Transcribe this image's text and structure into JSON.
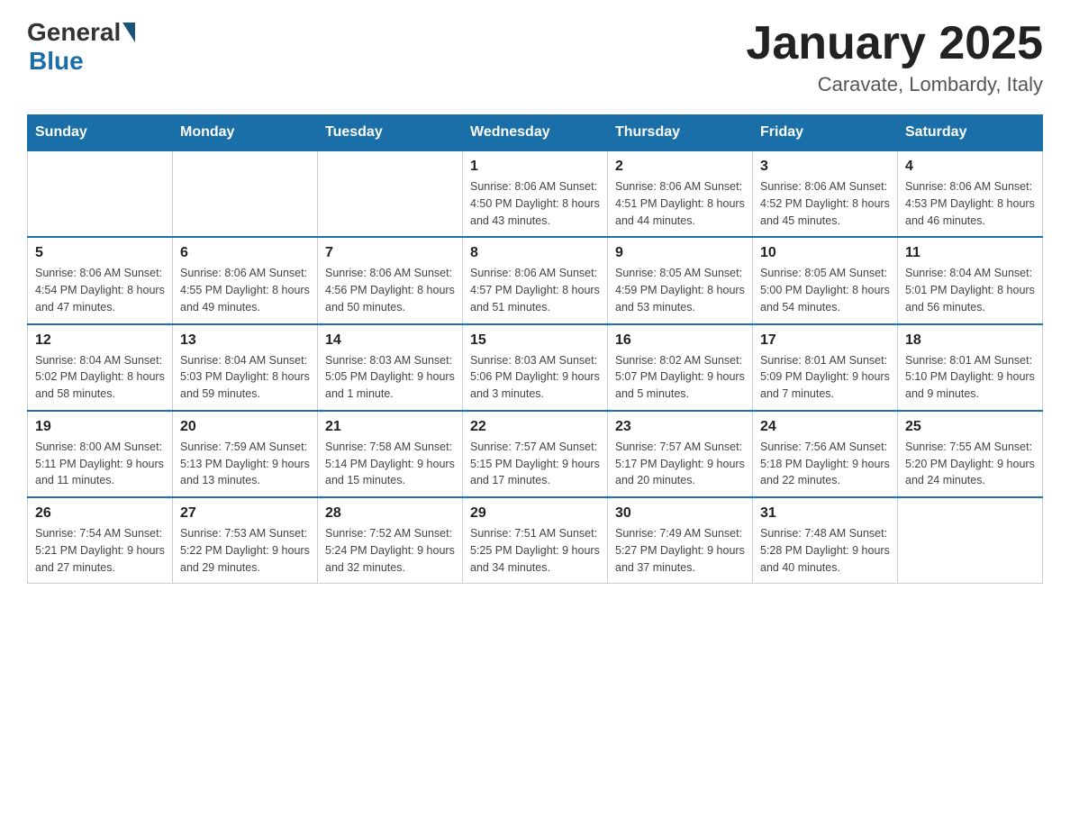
{
  "header": {
    "logo_general": "General",
    "logo_blue": "Blue",
    "month_title": "January 2025",
    "location": "Caravate, Lombardy, Italy"
  },
  "days_of_week": [
    "Sunday",
    "Monday",
    "Tuesday",
    "Wednesday",
    "Thursday",
    "Friday",
    "Saturday"
  ],
  "weeks": [
    [
      {
        "day": "",
        "info": ""
      },
      {
        "day": "",
        "info": ""
      },
      {
        "day": "",
        "info": ""
      },
      {
        "day": "1",
        "info": "Sunrise: 8:06 AM\nSunset: 4:50 PM\nDaylight: 8 hours\nand 43 minutes."
      },
      {
        "day": "2",
        "info": "Sunrise: 8:06 AM\nSunset: 4:51 PM\nDaylight: 8 hours\nand 44 minutes."
      },
      {
        "day": "3",
        "info": "Sunrise: 8:06 AM\nSunset: 4:52 PM\nDaylight: 8 hours\nand 45 minutes."
      },
      {
        "day": "4",
        "info": "Sunrise: 8:06 AM\nSunset: 4:53 PM\nDaylight: 8 hours\nand 46 minutes."
      }
    ],
    [
      {
        "day": "5",
        "info": "Sunrise: 8:06 AM\nSunset: 4:54 PM\nDaylight: 8 hours\nand 47 minutes."
      },
      {
        "day": "6",
        "info": "Sunrise: 8:06 AM\nSunset: 4:55 PM\nDaylight: 8 hours\nand 49 minutes."
      },
      {
        "day": "7",
        "info": "Sunrise: 8:06 AM\nSunset: 4:56 PM\nDaylight: 8 hours\nand 50 minutes."
      },
      {
        "day": "8",
        "info": "Sunrise: 8:06 AM\nSunset: 4:57 PM\nDaylight: 8 hours\nand 51 minutes."
      },
      {
        "day": "9",
        "info": "Sunrise: 8:05 AM\nSunset: 4:59 PM\nDaylight: 8 hours\nand 53 minutes."
      },
      {
        "day": "10",
        "info": "Sunrise: 8:05 AM\nSunset: 5:00 PM\nDaylight: 8 hours\nand 54 minutes."
      },
      {
        "day": "11",
        "info": "Sunrise: 8:04 AM\nSunset: 5:01 PM\nDaylight: 8 hours\nand 56 minutes."
      }
    ],
    [
      {
        "day": "12",
        "info": "Sunrise: 8:04 AM\nSunset: 5:02 PM\nDaylight: 8 hours\nand 58 minutes."
      },
      {
        "day": "13",
        "info": "Sunrise: 8:04 AM\nSunset: 5:03 PM\nDaylight: 8 hours\nand 59 minutes."
      },
      {
        "day": "14",
        "info": "Sunrise: 8:03 AM\nSunset: 5:05 PM\nDaylight: 9 hours\nand 1 minute."
      },
      {
        "day": "15",
        "info": "Sunrise: 8:03 AM\nSunset: 5:06 PM\nDaylight: 9 hours\nand 3 minutes."
      },
      {
        "day": "16",
        "info": "Sunrise: 8:02 AM\nSunset: 5:07 PM\nDaylight: 9 hours\nand 5 minutes."
      },
      {
        "day": "17",
        "info": "Sunrise: 8:01 AM\nSunset: 5:09 PM\nDaylight: 9 hours\nand 7 minutes."
      },
      {
        "day": "18",
        "info": "Sunrise: 8:01 AM\nSunset: 5:10 PM\nDaylight: 9 hours\nand 9 minutes."
      }
    ],
    [
      {
        "day": "19",
        "info": "Sunrise: 8:00 AM\nSunset: 5:11 PM\nDaylight: 9 hours\nand 11 minutes."
      },
      {
        "day": "20",
        "info": "Sunrise: 7:59 AM\nSunset: 5:13 PM\nDaylight: 9 hours\nand 13 minutes."
      },
      {
        "day": "21",
        "info": "Sunrise: 7:58 AM\nSunset: 5:14 PM\nDaylight: 9 hours\nand 15 minutes."
      },
      {
        "day": "22",
        "info": "Sunrise: 7:57 AM\nSunset: 5:15 PM\nDaylight: 9 hours\nand 17 minutes."
      },
      {
        "day": "23",
        "info": "Sunrise: 7:57 AM\nSunset: 5:17 PM\nDaylight: 9 hours\nand 20 minutes."
      },
      {
        "day": "24",
        "info": "Sunrise: 7:56 AM\nSunset: 5:18 PM\nDaylight: 9 hours\nand 22 minutes."
      },
      {
        "day": "25",
        "info": "Sunrise: 7:55 AM\nSunset: 5:20 PM\nDaylight: 9 hours\nand 24 minutes."
      }
    ],
    [
      {
        "day": "26",
        "info": "Sunrise: 7:54 AM\nSunset: 5:21 PM\nDaylight: 9 hours\nand 27 minutes."
      },
      {
        "day": "27",
        "info": "Sunrise: 7:53 AM\nSunset: 5:22 PM\nDaylight: 9 hours\nand 29 minutes."
      },
      {
        "day": "28",
        "info": "Sunrise: 7:52 AM\nSunset: 5:24 PM\nDaylight: 9 hours\nand 32 minutes."
      },
      {
        "day": "29",
        "info": "Sunrise: 7:51 AM\nSunset: 5:25 PM\nDaylight: 9 hours\nand 34 minutes."
      },
      {
        "day": "30",
        "info": "Sunrise: 7:49 AM\nSunset: 5:27 PM\nDaylight: 9 hours\nand 37 minutes."
      },
      {
        "day": "31",
        "info": "Sunrise: 7:48 AM\nSunset: 5:28 PM\nDaylight: 9 hours\nand 40 minutes."
      },
      {
        "day": "",
        "info": ""
      }
    ]
  ]
}
